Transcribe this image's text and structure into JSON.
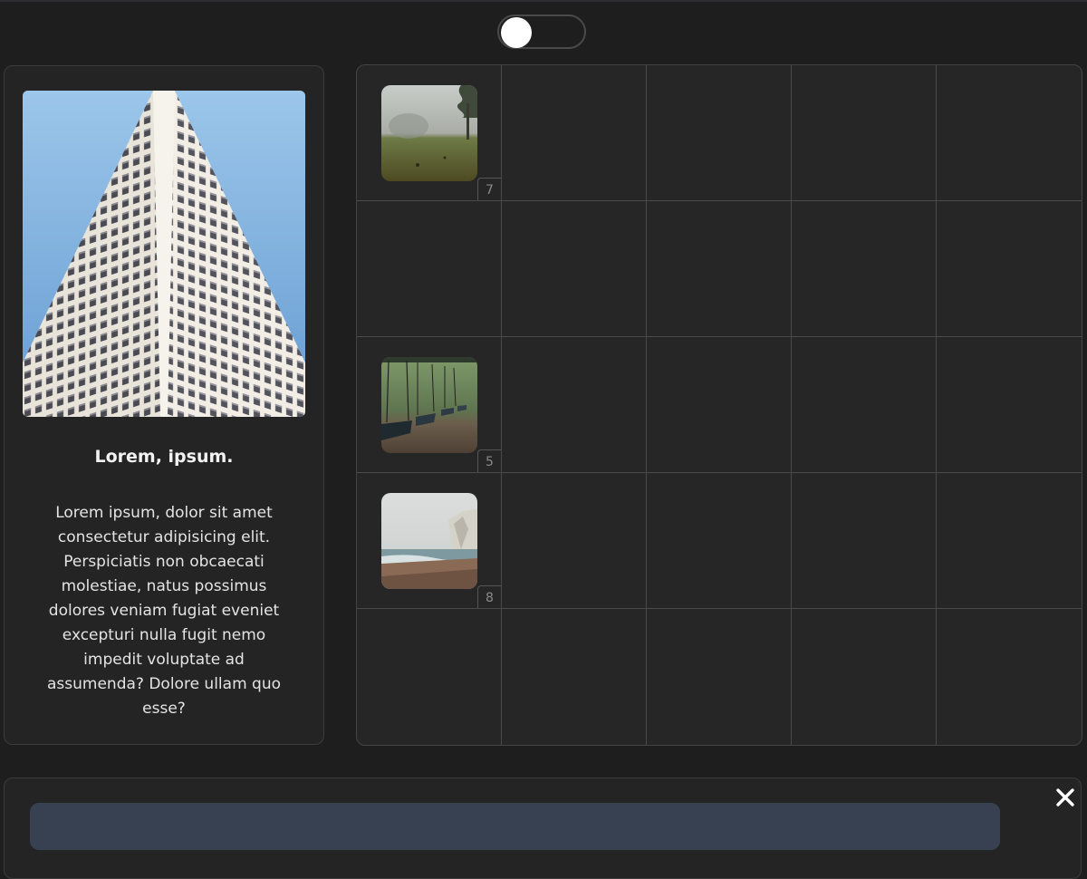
{
  "toggle": {
    "state": "off"
  },
  "card": {
    "image": "tall-building-photo",
    "title": "Lorem, ipsum.",
    "text": "Lorem ipsum, dolor sit amet consectetur adipisicing elit. Perspiciatis non obcaecati molestiae, natus possimus dolores veniam fugiat eveniet excepturi nulla fugit nemo impedit voluptate ad assumenda? Dolore ullam quo esse?"
  },
  "grid": {
    "rows": 5,
    "columns": 5,
    "items": [
      {
        "image": "foggy-meadow-photo",
        "badge": "7"
      },
      {
        "image": "swings-photo",
        "badge": "5"
      },
      {
        "image": "foggy-beach-cliff-photo",
        "badge": "8"
      }
    ]
  },
  "bottom": {
    "input_value": "",
    "close_icon": "close-icon"
  },
  "colors": {
    "background": "#1e1e1e",
    "panel": "#242424",
    "input": "#374151"
  }
}
